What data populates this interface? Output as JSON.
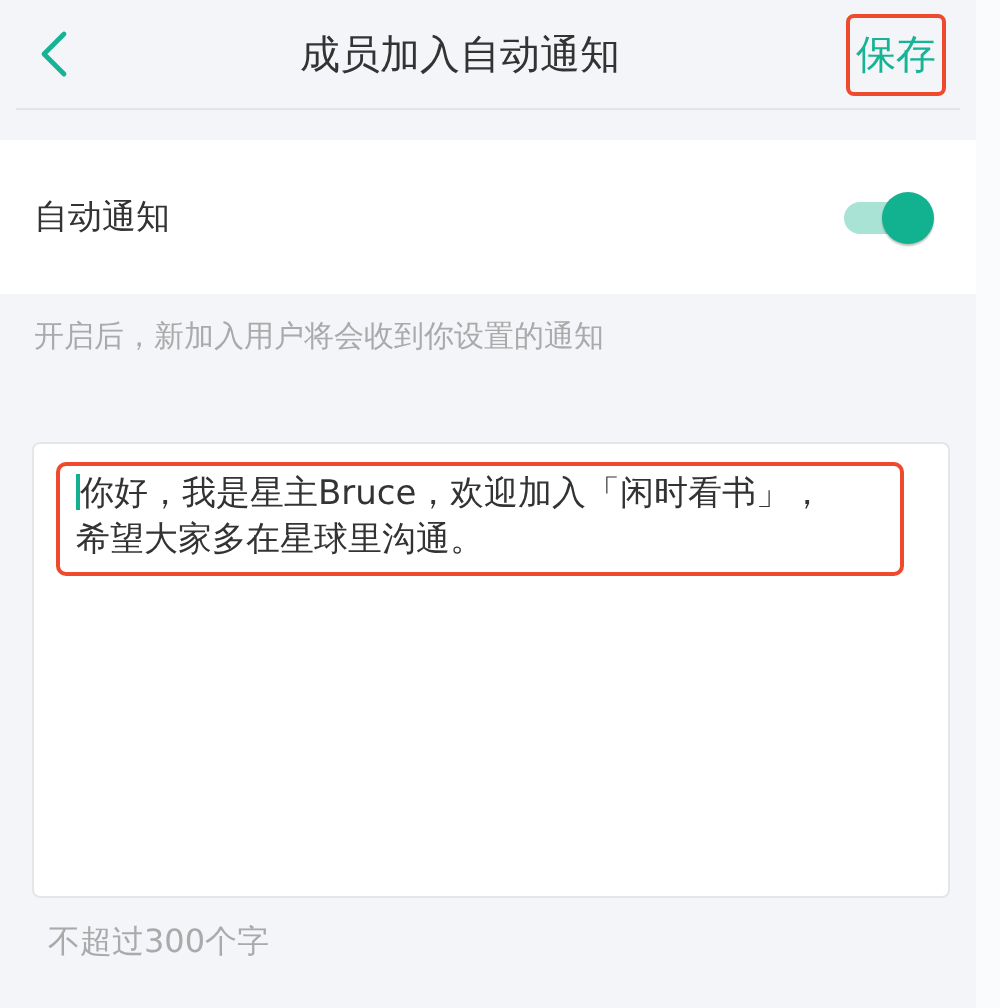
{
  "header": {
    "title": "成员加入自动通知",
    "save": {
      "label": "保存",
      "highlighted": true
    }
  },
  "setting": {
    "label": "自动通知",
    "on": true
  },
  "hint": "开启后，新加入用户将会收到你设置的通知",
  "message": {
    "value": "你好，我是星主Bruce，欢迎加入「闲时看书」，希望大家多在星球里沟通。",
    "focused": true,
    "highlighted": true
  },
  "limit": "不超过300个字"
}
